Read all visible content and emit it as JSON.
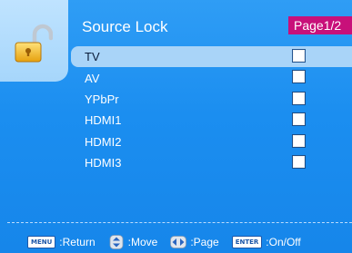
{
  "header": {
    "title": "Source Lock",
    "page_indicator": "Page1/2",
    "icon": "padlock-open-icon"
  },
  "sources": [
    {
      "label": "TV",
      "selected": true,
      "checked": false
    },
    {
      "label": "AV",
      "selected": false,
      "checked": false
    },
    {
      "label": "YPbPr",
      "selected": false,
      "checked": false
    },
    {
      "label": "HDMI1",
      "selected": false,
      "checked": false
    },
    {
      "label": "HDMI2",
      "selected": false,
      "checked": false
    },
    {
      "label": "HDMI3",
      "selected": false,
      "checked": false
    }
  ],
  "footer": {
    "menu_key": "MENU",
    "menu_action": ":Return",
    "move_icon": "up-down-arrows-icon",
    "move_action": ":Move",
    "page_icon": "left-right-arrows-icon",
    "page_action": ":Page",
    "enter_key": "ENTER",
    "enter_action": ":On/Off"
  },
  "colors": {
    "background": "#1b8ef0",
    "highlight": "#a9d4f8",
    "page_badge": "#c8107a"
  }
}
